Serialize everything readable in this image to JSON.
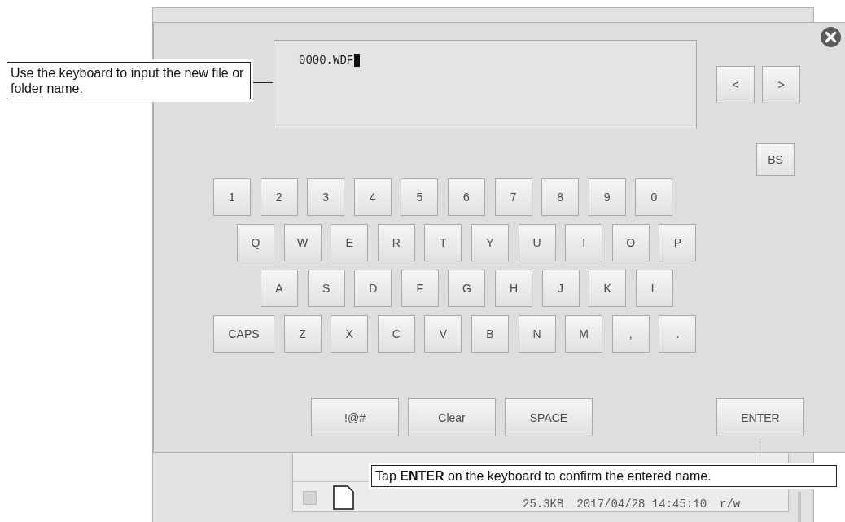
{
  "background_window": {
    "file_rows": [
      {
        "checked": false,
        "size": "25.3KB",
        "date": "2017/04/28 14:45:10",
        "attributes": "r/w"
      }
    ]
  },
  "dialog": {
    "input_value": "0000.WDF",
    "nav_keys": [
      "<",
      ">"
    ],
    "backspace_key": "BS",
    "key_rows": [
      [
        "1",
        "2",
        "3",
        "4",
        "5",
        "6",
        "7",
        "8",
        "9",
        "0"
      ],
      [
        "Q",
        "W",
        "E",
        "R",
        "T",
        "Y",
        "U",
        "I",
        "O",
        "P"
      ],
      [
        "A",
        "S",
        "D",
        "F",
        "G",
        "H",
        "J",
        "K",
        "L"
      ],
      [
        "Z",
        "X",
        "C",
        "V",
        "B",
        "N",
        "M",
        ",",
        "."
      ]
    ],
    "caps_key": "CAPS",
    "bottom_keys": [
      "!@#",
      "Clear",
      "SPACE"
    ],
    "enter_key": "ENTER"
  },
  "callouts": [
    {
      "text": "Use the keyboard to input the new file or folder name."
    },
    {
      "text": "Tap **ENTER** on the keyboard to confirm the entered name."
    }
  ]
}
